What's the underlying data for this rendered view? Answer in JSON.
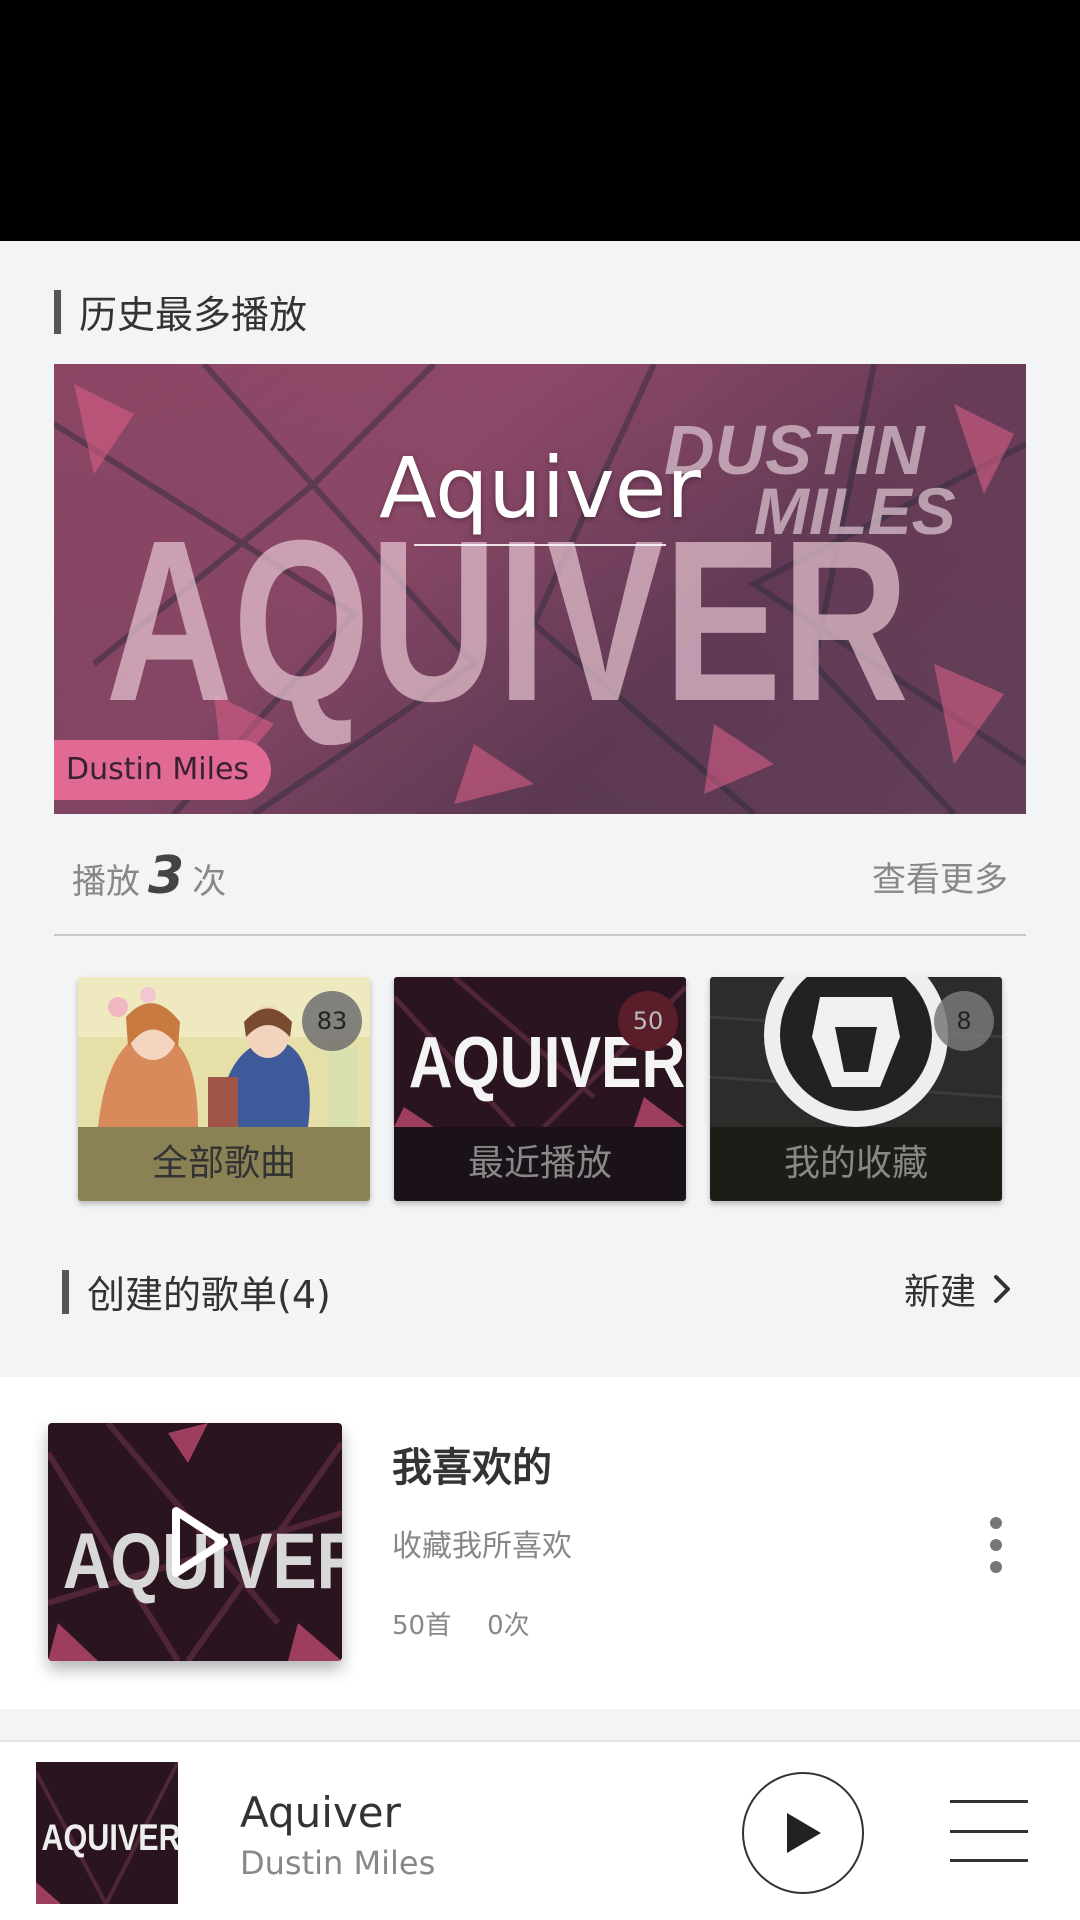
{
  "sections": {
    "history_title": "历史最多播放",
    "playlists_title": "创建的歌单(4)",
    "new_label": "新建"
  },
  "hero": {
    "title": "Aquiver",
    "artist": "Dustin Miles",
    "art_text_main": "AQUIVER",
    "art_text_sub1": "DUSTIN",
    "art_text_sub2": "MILES"
  },
  "play_stats": {
    "prefix": "播放",
    "count": "3",
    "suffix": "次",
    "more_label": "查看更多"
  },
  "cards": [
    {
      "label": "全部歌曲",
      "badge": "83"
    },
    {
      "label": "最近播放",
      "badge": "50",
      "art_text": "AQUIVER"
    },
    {
      "label": "我的收藏",
      "badge": "8"
    }
  ],
  "playlist_item": {
    "title": "我喜欢的",
    "desc": "收藏我所喜欢",
    "songs": "50首",
    "plays": "0次",
    "art_text": "AQUIVER"
  },
  "player": {
    "title": "Aquiver",
    "artist": "Dustin Miles",
    "art_text": "AQUIVER"
  },
  "icons": [
    "play-icon",
    "chevron-right-icon",
    "more-vert-icon",
    "menu-icon"
  ],
  "colors": {
    "accent_pink": "#e06a93",
    "card1_label_bg": "#8a8155",
    "card2_label_bg": "#1a1218",
    "card3_label_bg": "#1e1c16"
  }
}
